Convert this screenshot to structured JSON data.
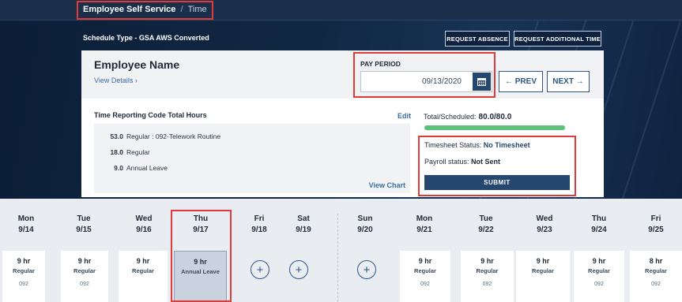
{
  "breadcrumb": {
    "root": "Employee Self Service",
    "separator": "/",
    "current": "Time"
  },
  "schedule": {
    "label": "Schedule Type - ",
    "value": "GSA AWS Converted"
  },
  "actions": {
    "request_absence": "REQUEST ABSENCE",
    "request_additional_time": "REQUEST ADDITIONAL TIME"
  },
  "employee": {
    "name": "Employee Name",
    "view_details": "View Details ›"
  },
  "pay_period": {
    "label": "PAY PERIOD",
    "value": "09/13/2020",
    "prev": "← PREV",
    "next": "NEXT →"
  },
  "trc": {
    "title": "Time Reporting Code Total Hours",
    "edit": "Edit",
    "view_chart": "View Chart",
    "rows": [
      {
        "hours": "53.0",
        "label": "Regular : 092-Telework Routine"
      },
      {
        "hours": "18.0",
        "label": "Regular"
      },
      {
        "hours": "9.0",
        "label": "Annual Leave"
      }
    ]
  },
  "totals": {
    "label": "Total/Scheduled:",
    "value": "80.0/80.0",
    "progress": 1.0
  },
  "status": {
    "timesheet_label": "Timesheet Status:",
    "timesheet_value": "No Timesheet",
    "payroll_label": "Payroll status:",
    "payroll_value": "Not Sent",
    "submit": "SUBMIT"
  },
  "days": [
    {
      "day": "Mon",
      "date": "9/14",
      "hours": "9 hr",
      "type": "Regular",
      "code": "092"
    },
    {
      "day": "Tue",
      "date": "9/15",
      "hours": "9 hr",
      "type": "Regular",
      "code": "092"
    },
    {
      "day": "Wed",
      "date": "9/16",
      "hours": "9 hr",
      "type": "Regular",
      "code": ""
    },
    {
      "day": "Thu",
      "date": "9/17",
      "hours": "9 hr",
      "type": "Annual Leave",
      "code": ""
    },
    {
      "day": "Fri",
      "date": "9/18"
    },
    {
      "day": "Sat",
      "date": "9/19"
    },
    {
      "day": "Sun",
      "date": "9/20"
    },
    {
      "day": "Mon",
      "date": "9/21",
      "hours": "9 hr",
      "type": "Regular",
      "code": "092"
    },
    {
      "day": "Tue",
      "date": "9/22",
      "hours": "9 hr",
      "type": "Regular",
      "code": "092"
    },
    {
      "day": "Wed",
      "date": "9/23",
      "hours": "9 hr",
      "type": "Regular",
      "code": ""
    },
    {
      "day": "Thu",
      "date": "9/24",
      "hours": "9 hr",
      "type": "Regular",
      "code": "092"
    },
    {
      "day": "Fri",
      "date": "9/25",
      "hours": "8 hr",
      "type": "Regular",
      "code": "092"
    }
  ],
  "colors": {
    "brand_navy": "#23476f",
    "highlight_red": "#e03a3a",
    "progress_green": "#5bc17a"
  }
}
